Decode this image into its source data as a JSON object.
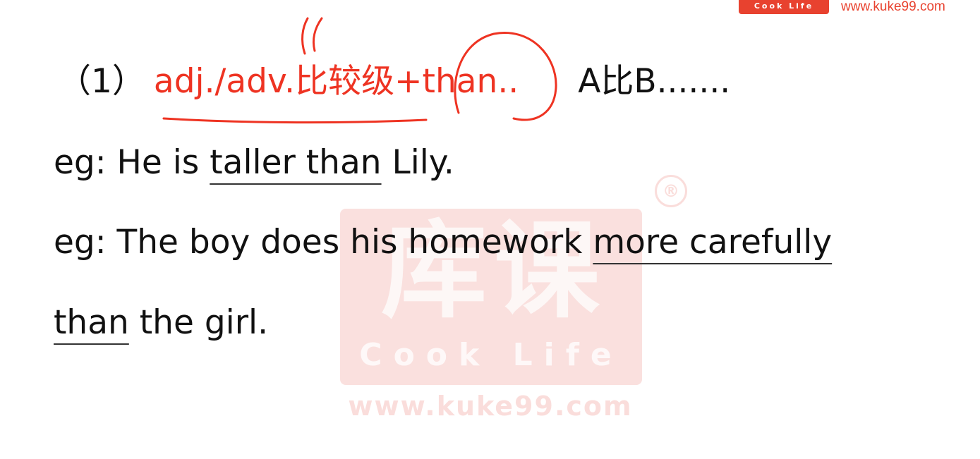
{
  "branding": {
    "badge": "Cook Life",
    "url": "www.kuke99.com"
  },
  "watermark": {
    "logo": "库课",
    "cook": "Cook Life",
    "url": "www.kuke99.com",
    "reg": "®"
  },
  "rule": {
    "number": "（1）",
    "pattern_a": "adj./adv.比较级",
    "plus": "+",
    "pattern_b": "than",
    "dots": "..",
    "meaning": "A比B......."
  },
  "example1": {
    "prefix": "eg: He is ",
    "underlined": "taller than",
    "suffix": " Lily."
  },
  "example2": {
    "prefix": "eg: The boy does his homework ",
    "underlined_a": "more carefully",
    "underlined_b": "than",
    "suffix": " the girl."
  },
  "colors": {
    "accent_red": "#ee3322",
    "brand_red": "#e8422f",
    "text": "#111111"
  }
}
